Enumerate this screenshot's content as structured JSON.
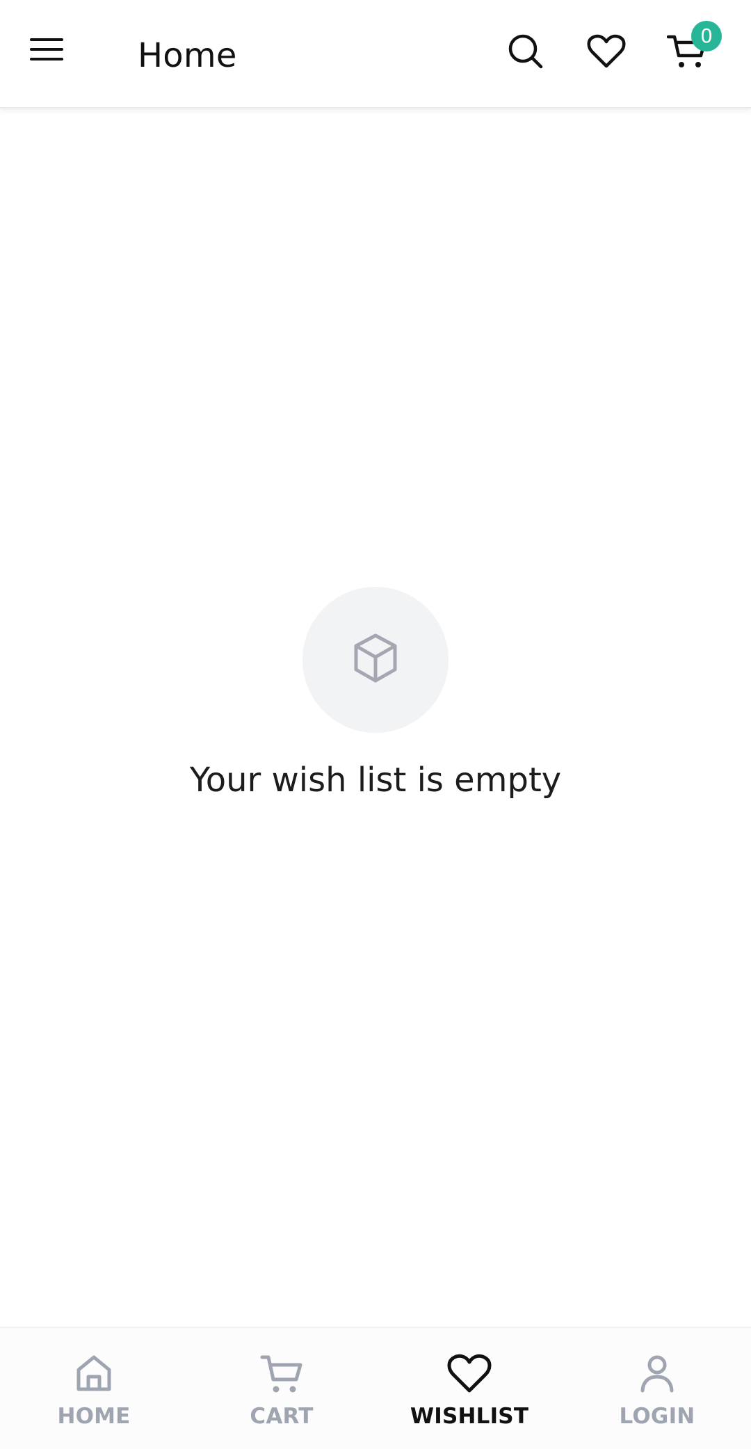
{
  "header": {
    "title": "Home",
    "menu_icon": "menu-icon",
    "search_icon": "search-icon",
    "wishlist_icon": "heart-icon",
    "cart_icon": "cart-icon",
    "cart_count": "0"
  },
  "empty_state": {
    "icon": "box-icon",
    "message": "Your wish list is empty"
  },
  "bottom_nav": {
    "items": [
      {
        "label": "HOME",
        "icon": "home-icon",
        "active": false
      },
      {
        "label": "CART",
        "icon": "cart-icon",
        "active": false
      },
      {
        "label": "WISHLIST",
        "icon": "heart-icon",
        "active": true
      },
      {
        "label": "LOGIN",
        "icon": "user-icon",
        "active": false
      }
    ]
  },
  "colors": {
    "badge": "#26b596",
    "inactive_nav": "#9ea4b0",
    "active_nav": "#111111",
    "empty_icon_bg": "#f2f3f5"
  }
}
